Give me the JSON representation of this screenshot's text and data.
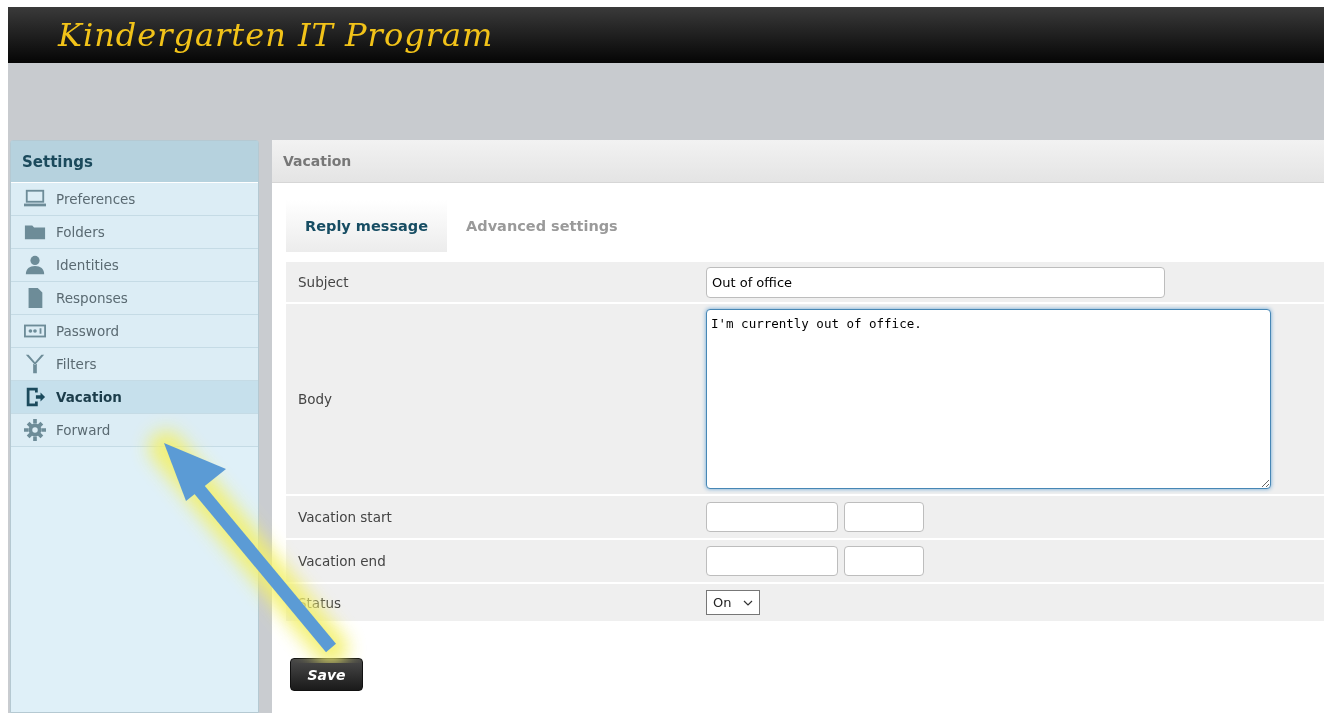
{
  "header": {
    "title": "Kindergarten IT Program"
  },
  "sidebar": {
    "title": "Settings",
    "items": [
      {
        "label": "Preferences",
        "selected": false
      },
      {
        "label": "Folders",
        "selected": false
      },
      {
        "label": "Identities",
        "selected": false
      },
      {
        "label": "Responses",
        "selected": false
      },
      {
        "label": "Password",
        "selected": false
      },
      {
        "label": "Filters",
        "selected": false
      },
      {
        "label": "Vacation",
        "selected": true
      },
      {
        "label": "Forward",
        "selected": false
      }
    ]
  },
  "main": {
    "title": "Vacation",
    "tabs": [
      {
        "label": "Reply message",
        "selected": true
      },
      {
        "label": "Advanced settings",
        "selected": false
      }
    ],
    "form": [
      {
        "kind": "text",
        "label": "Subject",
        "value": "Out of office"
      },
      {
        "kind": "textarea",
        "label": "Body",
        "value": "I'm currently out of office.",
        "focused": true
      },
      {
        "kind": "datetime",
        "label": "Vacation start"
      },
      {
        "kind": "datetime",
        "label": "Vacation end"
      },
      {
        "kind": "select",
        "label": "Status",
        "value": "On"
      }
    ],
    "save_button": "Save"
  }
}
